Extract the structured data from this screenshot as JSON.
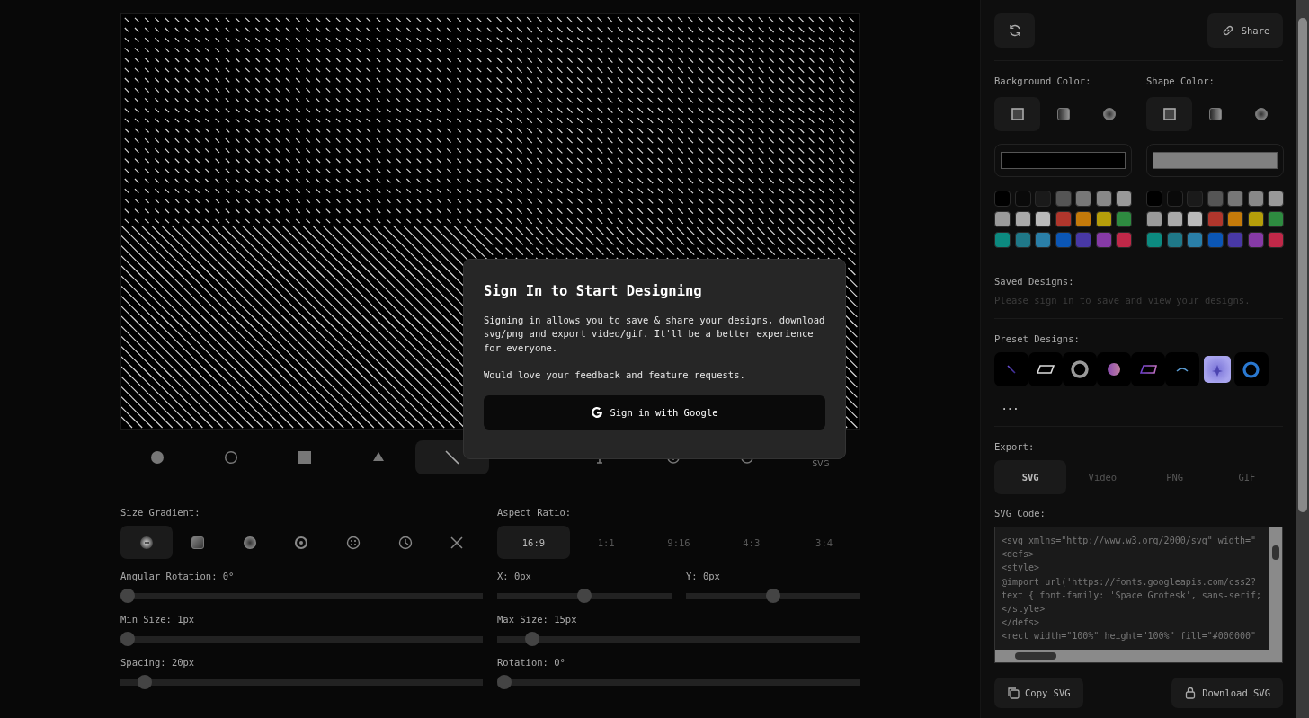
{
  "shapes": [
    {
      "kind": "circle",
      "selected": false
    },
    {
      "kind": "ring",
      "selected": false
    },
    {
      "kind": "square",
      "selected": false
    },
    {
      "kind": "triangle",
      "selected": false
    },
    {
      "kind": "line",
      "selected": true
    },
    {
      "kind": "cursor",
      "selected": false
    },
    {
      "kind": "info",
      "selected": false
    },
    {
      "kind": "target",
      "selected": false
    },
    {
      "kind": "svg",
      "label": "SVG",
      "selected": false
    }
  ],
  "modal": {
    "title": "Sign In to Start Designing",
    "paragraphs": [
      "Signing in allows you to save & share your designs, download svg/png and export video/gif. It'll be a better experience for everyone.",
      "Would love your feedback and feature requests."
    ],
    "button": "Sign in with Google"
  },
  "size_gradient": {
    "label": "Size Gradient:",
    "options": [
      {
        "kind": "radial-dash",
        "selected": true
      },
      {
        "kind": "square-gradient",
        "selected": false
      },
      {
        "kind": "radial",
        "selected": false
      },
      {
        "kind": "ring-dot",
        "selected": false
      },
      {
        "kind": "dots",
        "selected": false
      },
      {
        "kind": "clock",
        "selected": false
      },
      {
        "kind": "none",
        "selected": false
      }
    ]
  },
  "aspect_ratio": {
    "label": "Aspect Ratio:",
    "options": [
      {
        "label": "16:9",
        "selected": true
      },
      {
        "label": "1:1",
        "selected": false
      },
      {
        "label": "9:16",
        "selected": false
      },
      {
        "label": "4:3",
        "selected": false
      },
      {
        "label": "3:4",
        "selected": false
      }
    ]
  },
  "slider_rows": [
    [
      {
        "label": "Angular Rotation: 0°",
        "level": 0
      },
      {
        "label": "X: 0px",
        "level": 0.5
      },
      {
        "label": "Y: 0px",
        "level": 0.5
      }
    ],
    [
      {
        "label": "Min Size: 1px",
        "level": 0
      },
      {
        "label": "Max Size: 15px",
        "level": 0.08
      }
    ],
    [
      {
        "label": "Spacing: 20px",
        "level": 0.05
      },
      {
        "label": "Rotation: 0°",
        "level": 0
      }
    ]
  ],
  "toolbar": {
    "share": "Share"
  },
  "colors": [
    {
      "label": "Background Color:",
      "fill_types": [
        {
          "kind": "solid",
          "selected": true
        },
        {
          "kind": "linear",
          "selected": false
        },
        {
          "kind": "radial",
          "selected": false
        }
      ],
      "color": "#000000",
      "swatches": [
        {
          "color": "#000000"
        },
        {
          "color": "#0a0a0a"
        },
        {
          "color": "#1a1a1a"
        },
        {
          "color": "#555555"
        },
        {
          "color": "#777777"
        },
        {
          "color": "#888888"
        },
        {
          "color": "#999999"
        },
        {
          "color": "#9a9a9a"
        },
        {
          "color": "#aaaaaa"
        },
        {
          "color": "#bbbbbb"
        },
        {
          "color": "#b0362c"
        },
        {
          "color": "#c47a0a"
        },
        {
          "color": "#b59e0a"
        },
        {
          "color": "#2e8b40"
        },
        {
          "color": "#0c8a80"
        },
        {
          "color": "#1f7888"
        },
        {
          "color": "#2a7fa8"
        },
        {
          "color": "#0b56b5"
        },
        {
          "color": "#4838a5"
        },
        {
          "color": "#863aa6"
        },
        {
          "color": "#c02848"
        }
      ]
    },
    {
      "label": "Shape Color:",
      "fill_types": [
        {
          "kind": "solid",
          "selected": true
        },
        {
          "kind": "linear",
          "selected": false
        },
        {
          "kind": "radial",
          "selected": false
        }
      ],
      "color": "#808080",
      "swatches": [
        {
          "color": "#000000"
        },
        {
          "color": "#0a0a0a"
        },
        {
          "color": "#1a1a1a"
        },
        {
          "color": "#555555"
        },
        {
          "color": "#777777"
        },
        {
          "color": "#888888"
        },
        {
          "color": "#999999"
        },
        {
          "color": "#9a9a9a"
        },
        {
          "color": "#aaaaaa"
        },
        {
          "color": "#bbbbbb"
        },
        {
          "color": "#b0362c"
        },
        {
          "color": "#c47a0a"
        },
        {
          "color": "#b59e0a"
        },
        {
          "color": "#2e8b40"
        },
        {
          "color": "#0c8a80"
        },
        {
          "color": "#1f7888"
        },
        {
          "color": "#2a7fa8"
        },
        {
          "color": "#0b56b5"
        },
        {
          "color": "#4838a5"
        },
        {
          "color": "#863aa6"
        },
        {
          "color": "#c02848"
        }
      ]
    }
  ],
  "saved_designs": {
    "label": "Saved Designs:",
    "message": "Please sign in to save and view your designs."
  },
  "preset_designs": {
    "label": "Preset Designs:",
    "items": [
      {
        "kind": "line"
      },
      {
        "kind": "parallelogram"
      },
      {
        "kind": "ring"
      },
      {
        "kind": "ball"
      },
      {
        "kind": "parallelogram-gradient"
      },
      {
        "kind": "arc"
      },
      {
        "kind": "star"
      },
      {
        "kind": "bold-ring"
      }
    ],
    "more": "..."
  },
  "export": {
    "label": "Export:",
    "tabs": [
      {
        "label": "SVG",
        "selected": true
      },
      {
        "label": "Video",
        "selected": false
      },
      {
        "label": "PNG",
        "selected": false
      },
      {
        "label": "GIF",
        "selected": false
      }
    ]
  },
  "svg_code": {
    "label": "SVG Code:",
    "lines": [
      "<svg xmlns=\"http://www.w3.org/2000/svg\" width=\"",
      "<defs>",
      "<style>",
      "@import url('https://fonts.googleapis.com/css2?",
      "text { font-family: 'Space Grotesk', sans-serif;",
      "</style>",
      "</defs>",
      "<rect width=\"100%\" height=\"100%\" fill=\"#000000\""
    ]
  },
  "actions": [
    "Copy SVG",
    "Download SVG"
  ]
}
